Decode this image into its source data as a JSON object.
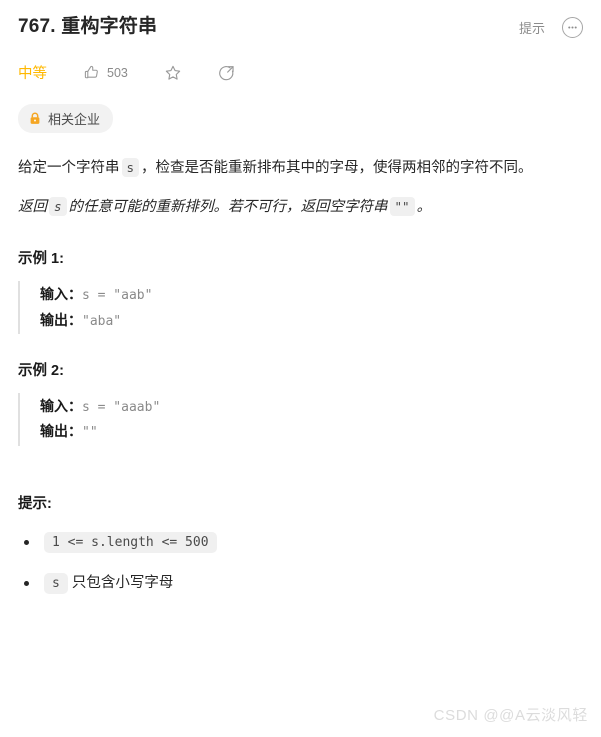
{
  "header": {
    "title": "767. 重构字符串",
    "hint_label": "提示",
    "more_icon": "ellipsis-circle-icon"
  },
  "meta": {
    "difficulty": "中等",
    "difficulty_color": "#ffb800",
    "like_icon": "thumbs-up-icon",
    "like_count": "503",
    "favorite_icon": "star-outline-icon",
    "share_icon": "share-circle-icon"
  },
  "company_tag": {
    "lock_icon": "lock-icon",
    "label": "相关企业",
    "lock_color": "#f5a623"
  },
  "description": {
    "paragraph1": {
      "before": "给定一个字符串",
      "code": "s",
      "after": "，检查是否能重新排布其中的字母，使得两相邻的字符不同。"
    },
    "paragraph2": {
      "before": "返回",
      "code1": "s",
      "middle": "的任意可能的重新排列。若不可行，返回空字符串",
      "code2": "\"\"",
      "after": "。"
    }
  },
  "examples": [
    {
      "heading": "示例 1:",
      "input_label": "输入：",
      "input_value": "s = \"aab\"",
      "output_label": "输出：",
      "output_value": "\"aba\""
    },
    {
      "heading": "示例 2:",
      "input_label": "输入：",
      "input_value": "s = \"aaab\"",
      "output_label": "输出：",
      "output_value": "\"\""
    }
  ],
  "constraints": {
    "heading": "提示:",
    "items": [
      {
        "code": "1 <= s.length <= 500",
        "text": ""
      },
      {
        "code": "s",
        "text": "只包含小写字母"
      }
    ]
  },
  "watermark": "CSDN @@A云淡风轻"
}
